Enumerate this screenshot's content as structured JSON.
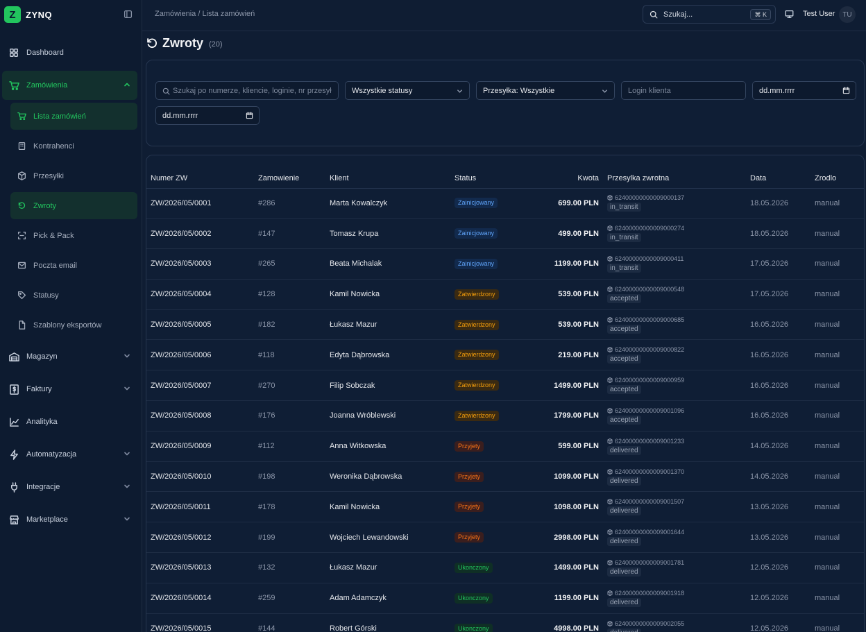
{
  "app": {
    "brand_initial": "Z",
    "brand_name": "ZYNQ"
  },
  "sidebar": {
    "items": [
      {
        "label": "Dashboard",
        "icon": "dashboard-icon"
      },
      {
        "label": "Zamówienia",
        "icon": "cart-icon"
      },
      {
        "label": "Magazyn",
        "icon": "warehouse-icon"
      },
      {
        "label": "Faktury",
        "icon": "invoice-icon"
      },
      {
        "label": "Analityka",
        "icon": "chart-line-icon"
      },
      {
        "label": "Automatyzacja",
        "icon": "bolt-icon"
      },
      {
        "label": "Integracje",
        "icon": "plug-icon"
      },
      {
        "label": "Marketplace",
        "icon": "store-icon"
      }
    ],
    "sub_items": [
      {
        "label": "Lista zamówień",
        "icon": "cart-icon"
      },
      {
        "label": "Kontrahenci",
        "icon": "building-icon"
      },
      {
        "label": "Przesyłki",
        "icon": "package-icon"
      },
      {
        "label": "Zwroty",
        "icon": "return-icon"
      },
      {
        "label": "Pick & Pack",
        "icon": "scan-icon"
      },
      {
        "label": "Poczta email",
        "icon": "mail-icon"
      },
      {
        "label": "Statusy",
        "icon": "tag-icon"
      },
      {
        "label": "Szablony eksportów",
        "icon": "file-icon"
      }
    ]
  },
  "topbar": {
    "breadcrumb": "Zamówienia / Lista zamówień",
    "search_label": "Szukaj...",
    "search_shortcut": "⌘ K",
    "user_name": "Test User",
    "user_initials": "TU"
  },
  "page": {
    "title": "Zwroty",
    "count": "(20)"
  },
  "filters": {
    "search_placeholder": "Szukaj po numerze, kliencie, loginie, nr przesyłki...",
    "status_value": "Wszystkie statusy",
    "shipment_value": "Przesyłka: Wszystkie",
    "login_placeholder": "Login klienta",
    "date_from": "dd.mm.rrrr",
    "date_to": "dd.mm.rrrr"
  },
  "table": {
    "columns": [
      "Numer ZW",
      "Zamowienie",
      "Klient",
      "Status",
      "Kwota",
      "Przesylka zwrotna",
      "Data",
      "Zrodlo"
    ],
    "rows": [
      {
        "number": "ZW/2026/05/0001",
        "order": "#286",
        "client": "Marta Kowalczyk",
        "status": "Zainicjowany",
        "status_type": "init",
        "amount": "699.00 PLN",
        "tracking": "62400000000009000137",
        "ship_status": "in_transit",
        "date": "18.05.2026",
        "source": "manual"
      },
      {
        "number": "ZW/2026/05/0002",
        "order": "#147",
        "client": "Tomasz Krupa",
        "status": "Zainicjowany",
        "status_type": "init",
        "amount": "499.00 PLN",
        "tracking": "62400000000009000274",
        "ship_status": "in_transit",
        "date": "18.05.2026",
        "source": "manual"
      },
      {
        "number": "ZW/2026/05/0003",
        "order": "#265",
        "client": "Beata Michalak",
        "status": "Zainicjowany",
        "status_type": "init",
        "amount": "1199.00 PLN",
        "tracking": "62400000000009000411",
        "ship_status": "in_transit",
        "date": "17.05.2026",
        "source": "manual"
      },
      {
        "number": "ZW/2026/05/0004",
        "order": "#128",
        "client": "Kamil Nowicka",
        "status": "Zatwierdzony",
        "status_type": "conf",
        "amount": "539.00 PLN",
        "tracking": "62400000000009000548",
        "ship_status": "accepted",
        "date": "17.05.2026",
        "source": "manual"
      },
      {
        "number": "ZW/2026/05/0005",
        "order": "#182",
        "client": "Łukasz Mazur",
        "status": "Zatwierdzony",
        "status_type": "conf",
        "amount": "539.00 PLN",
        "tracking": "62400000000009000685",
        "ship_status": "accepted",
        "date": "16.05.2026",
        "source": "manual"
      },
      {
        "number": "ZW/2026/05/0006",
        "order": "#118",
        "client": "Edyta Dąbrowska",
        "status": "Zatwierdzony",
        "status_type": "conf",
        "amount": "219.00 PLN",
        "tracking": "62400000000009000822",
        "ship_status": "accepted",
        "date": "16.05.2026",
        "source": "manual"
      },
      {
        "number": "ZW/2026/05/0007",
        "order": "#270",
        "client": "Filip Sobczak",
        "status": "Zatwierdzony",
        "status_type": "conf",
        "amount": "1499.00 PLN",
        "tracking": "62400000000009000959",
        "ship_status": "accepted",
        "date": "16.05.2026",
        "source": "manual"
      },
      {
        "number": "ZW/2026/05/0008",
        "order": "#176",
        "client": "Joanna Wróblewski",
        "status": "Zatwierdzony",
        "status_type": "conf",
        "amount": "1799.00 PLN",
        "tracking": "62400000000009001096",
        "ship_status": "accepted",
        "date": "16.05.2026",
        "source": "manual"
      },
      {
        "number": "ZW/2026/05/0009",
        "order": "#112",
        "client": "Anna Witkowska",
        "status": "Przyjety",
        "status_type": "recv",
        "amount": "599.00 PLN",
        "tracking": "62400000000009001233",
        "ship_status": "delivered",
        "date": "14.05.2026",
        "source": "manual"
      },
      {
        "number": "ZW/2026/05/0010",
        "order": "#198",
        "client": "Weronika Dąbrowska",
        "status": "Przyjety",
        "status_type": "recv",
        "amount": "1099.00 PLN",
        "tracking": "62400000000009001370",
        "ship_status": "delivered",
        "date": "14.05.2026",
        "source": "manual"
      },
      {
        "number": "ZW/2026/05/0011",
        "order": "#178",
        "client": "Kamil Nowicka",
        "status": "Przyjety",
        "status_type": "recv",
        "amount": "1098.00 PLN",
        "tracking": "62400000000009001507",
        "ship_status": "delivered",
        "date": "13.05.2026",
        "source": "manual"
      },
      {
        "number": "ZW/2026/05/0012",
        "order": "#199",
        "client": "Wojciech Lewandowski",
        "status": "Przyjety",
        "status_type": "recv",
        "amount": "2998.00 PLN",
        "tracking": "62400000000009001644",
        "ship_status": "delivered",
        "date": "13.05.2026",
        "source": "manual"
      },
      {
        "number": "ZW/2026/05/0013",
        "order": "#132",
        "client": "Łukasz Mazur",
        "status": "Ukonczony",
        "status_type": "done",
        "amount": "1499.00 PLN",
        "tracking": "62400000000009001781",
        "ship_status": "delivered",
        "date": "12.05.2026",
        "source": "manual"
      },
      {
        "number": "ZW/2026/05/0014",
        "order": "#259",
        "client": "Adam Adamczyk",
        "status": "Ukonczony",
        "status_type": "done",
        "amount": "1199.00 PLN",
        "tracking": "62400000000009001918",
        "ship_status": "delivered",
        "date": "12.05.2026",
        "source": "manual"
      },
      {
        "number": "ZW/2026/05/0015",
        "order": "#144",
        "client": "Robert Górski",
        "status": "Ukonczony",
        "status_type": "done",
        "amount": "4998.00 PLN",
        "tracking": "62400000000009002055",
        "ship_status": "delivered",
        "date": "12.05.2026",
        "source": "manual"
      }
    ]
  }
}
